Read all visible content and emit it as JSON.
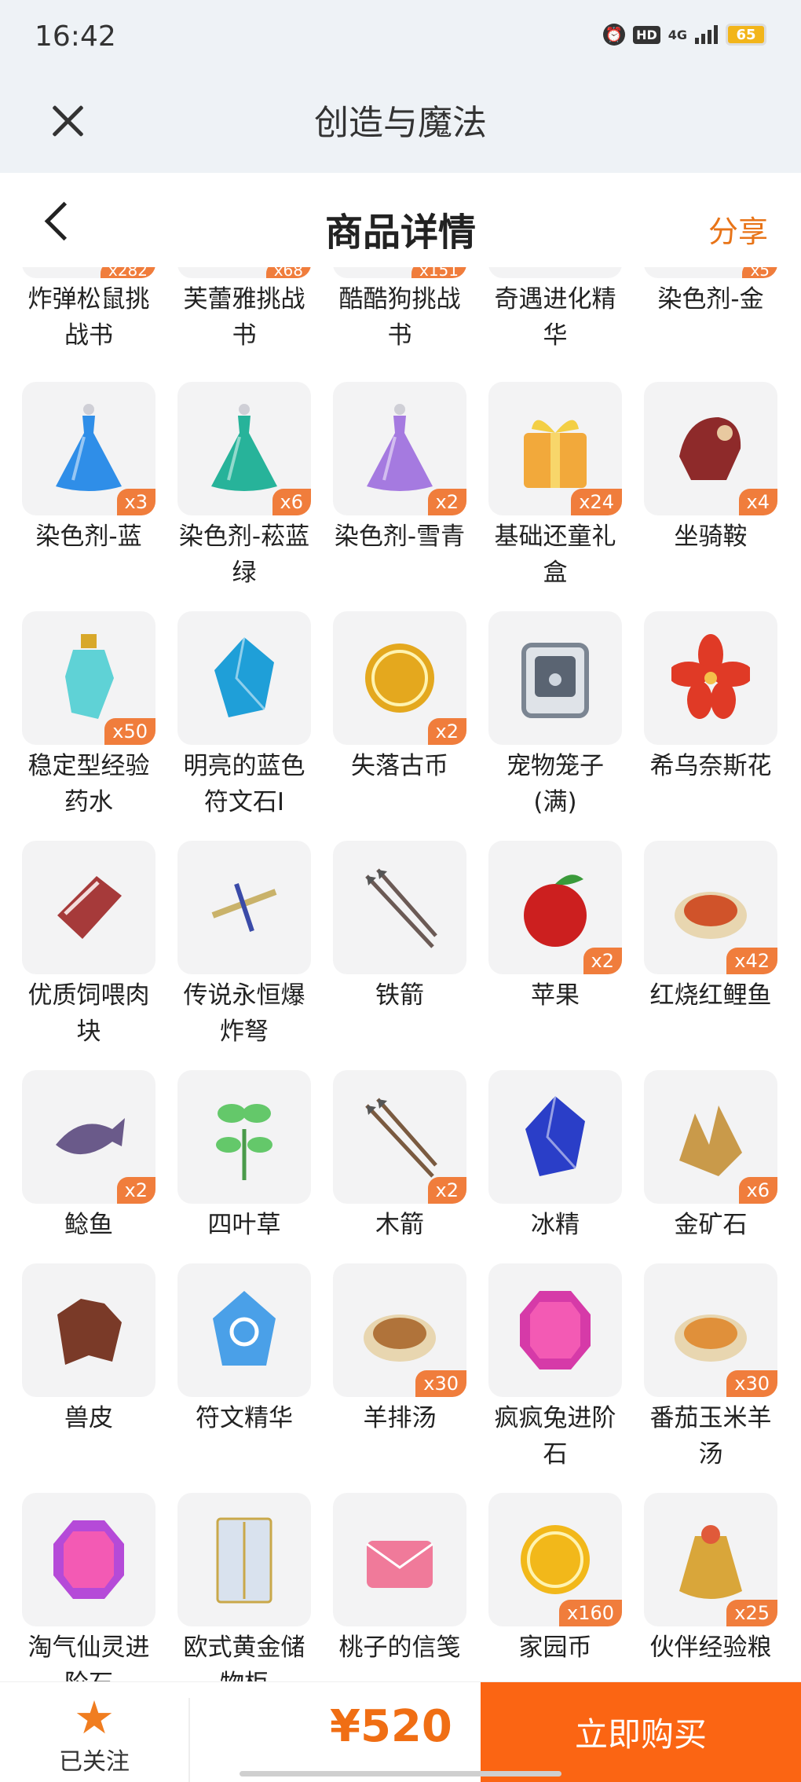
{
  "status_bar": {
    "time": "16:42",
    "hd": "HD",
    "network": "4G",
    "battery": "65"
  },
  "app_bar": {
    "title": "创造与魔法"
  },
  "nav_bar": {
    "title": "商品详情",
    "share": "分享"
  },
  "items": [
    {
      "label": "炸弹松鼠挑战书",
      "badge": "x282",
      "icon": "scroll-icon",
      "color": "#e8b070",
      "cut": true
    },
    {
      "label": "芙蕾雅挑战书",
      "badge": "x68",
      "icon": "scroll-icon",
      "color": "#e8b070",
      "cut": true
    },
    {
      "label": "酷酷狗挑战书",
      "badge": "x151",
      "icon": "scroll-icon",
      "color": "#e8b070",
      "cut": true
    },
    {
      "label": "奇遇进化精华",
      "badge": "",
      "icon": "essence-icon",
      "color": "#d0c0f0",
      "cut": true
    },
    {
      "label": "染色剂-金",
      "badge": "x5",
      "icon": "potion-icon",
      "color": "#e8c040",
      "cut": true
    },
    {
      "label": "染色剂-蓝",
      "badge": "x3",
      "icon": "dye-bottle-icon",
      "color": "#2f8ee8"
    },
    {
      "label": "染色剂-菘蓝绿",
      "badge": "x6",
      "icon": "dye-bottle-icon",
      "color": "#27b39a"
    },
    {
      "label": "染色剂-雪青",
      "badge": "x2",
      "icon": "dye-bottle-icon",
      "color": "#a57ae0"
    },
    {
      "label": "基础还童礼盒",
      "badge": "x24",
      "icon": "gift-box-icon",
      "color": "#f2a93b"
    },
    {
      "label": "坐骑鞍",
      "badge": "x4",
      "icon": "saddle-icon",
      "color": "#8e2a2a"
    },
    {
      "label": "稳定型经验药水",
      "badge": "x50",
      "icon": "potion-icon",
      "color": "#5fd2d6"
    },
    {
      "label": "明亮的蓝色符文石I",
      "badge": "",
      "icon": "crystal-icon",
      "color": "#1f9fd8"
    },
    {
      "label": "失落古币",
      "badge": "x2",
      "icon": "coin-icon",
      "color": "#e4a81e"
    },
    {
      "label": "宠物笼子(满)",
      "badge": "",
      "icon": "pet-cage-icon",
      "color": "#7b8592"
    },
    {
      "label": "希乌奈斯花",
      "badge": "",
      "icon": "flower-icon",
      "color": "#e03a26"
    },
    {
      "label": "优质饲喂肉块",
      "badge": "",
      "icon": "meat-icon",
      "color": "#a63a3a"
    },
    {
      "label": "传说永恒爆炸弩",
      "badge": "",
      "icon": "crossbow-icon",
      "color": "#c9b26a"
    },
    {
      "label": "铁箭",
      "badge": "",
      "icon": "arrow-icon",
      "color": "#6b5a55"
    },
    {
      "label": "苹果",
      "badge": "x2",
      "icon": "apple-icon",
      "color": "#cc1f1f"
    },
    {
      "label": "红烧红鲤鱼",
      "badge": "x42",
      "icon": "dish-icon",
      "color": "#d0532a"
    },
    {
      "label": "鲶鱼",
      "badge": "x2",
      "icon": "fish-icon",
      "color": "#6a5a8a"
    },
    {
      "label": "四叶草",
      "badge": "",
      "icon": "clover-icon",
      "color": "#64c86a"
    },
    {
      "label": "木箭",
      "badge": "x2",
      "icon": "arrow-icon",
      "color": "#7a5a40"
    },
    {
      "label": "冰精",
      "badge": "",
      "icon": "ice-crystal-icon",
      "color": "#2a3ec8"
    },
    {
      "label": "金矿石",
      "badge": "x6",
      "icon": "gold-ore-icon",
      "color": "#c99a4a"
    },
    {
      "label": "兽皮",
      "badge": "",
      "icon": "hide-icon",
      "color": "#7a3a28"
    },
    {
      "label": "符文精华",
      "badge": "",
      "icon": "rune-essence-icon",
      "color": "#4aa0e8"
    },
    {
      "label": "羊排汤",
      "badge": "x30",
      "icon": "soup-icon",
      "color": "#b0733a"
    },
    {
      "label": "疯疯兔进阶石",
      "badge": "",
      "icon": "gem-icon",
      "color": "#d63aa8"
    },
    {
      "label": "番茄玉米羊汤",
      "badge": "x30",
      "icon": "soup-icon",
      "color": "#e0903a"
    },
    {
      "label": "淘气仙灵进阶石",
      "badge": "",
      "icon": "gem-icon",
      "color": "#b54ad8"
    },
    {
      "label": "欧式黄金储物柜",
      "badge": "",
      "icon": "wardrobe-icon",
      "color": "#d9e2ee"
    },
    {
      "label": "桃子的信笺",
      "badge": "",
      "icon": "letter-icon",
      "color": "#f07a9a"
    },
    {
      "label": "家园币",
      "badge": "x160",
      "icon": "coin-icon",
      "color": "#f2b81a"
    },
    {
      "label": "伙伴经验粮",
      "badge": "x25",
      "icon": "bag-icon",
      "color": "#d9a63a"
    }
  ],
  "bottom_bar": {
    "fav_label": "已关注",
    "price": "¥520",
    "buy_label": "立即购买"
  }
}
